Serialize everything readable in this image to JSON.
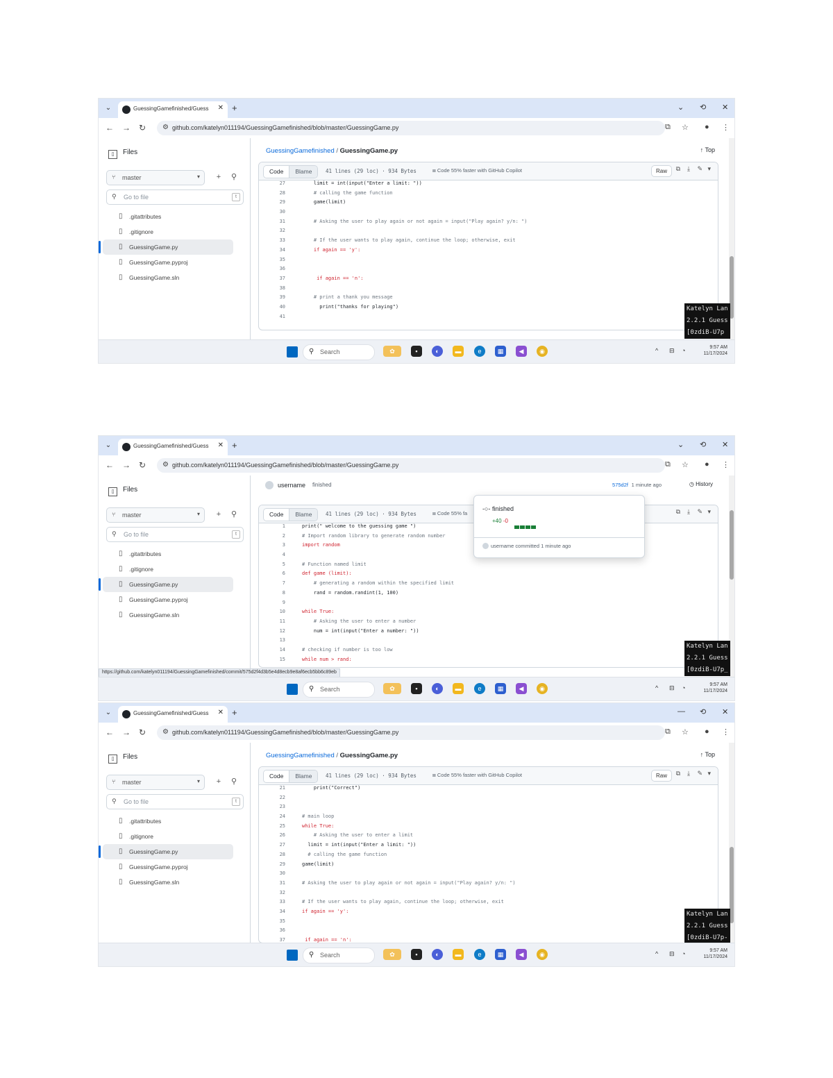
{
  "shots": [
    {
      "tab_title": "GuessingGamefinished/Guess",
      "url": "github.com/katelyn011194/GuessingGamefinished/blob/master/GuessingGame.py",
      "files_label": "Files",
      "branch": "master",
      "go_to_file": "Go to file",
      "files": [
        ".gitattributes",
        ".gitignore",
        "GuessingGame.py",
        "GuessingGame.pyproj",
        "GuessingGame.sln"
      ],
      "breadcrumb_repo": "GuessingGamefinished",
      "breadcrumb_sep": "/",
      "breadcrumb_file": "GuessingGame.py",
      "top_link": "Top",
      "view_code": "Code",
      "view_blame": "Blame",
      "file_info": "41 lines (29 loc) · 934 Bytes",
      "copilot": "Code 55% faster with GitHub Copilot",
      "raw": "Raw",
      "code_lines": [
        {
          "n": "27",
          "t": "    limit = int(input(\"Enter a limit: \"))"
        },
        {
          "n": "28",
          "t": "    # calling the game function"
        },
        {
          "n": "29",
          "t": "    game(limit)"
        },
        {
          "n": "30",
          "t": ""
        },
        {
          "n": "31",
          "t": "    # Asking the user to play again or not again = input(\"Play again? y/n: \")"
        },
        {
          "n": "32",
          "t": ""
        },
        {
          "n": "33",
          "t": "    # If the user wants to play again, continue the loop; otherwise, exit"
        },
        {
          "n": "34",
          "t": "    if again == 'y':"
        },
        {
          "n": "35",
          "t": ""
        },
        {
          "n": "36",
          "t": ""
        },
        {
          "n": "37",
          "t": "     if again == 'n':"
        },
        {
          "n": "38",
          "t": ""
        },
        {
          "n": "39",
          "t": "    # print a thank you message"
        },
        {
          "n": "40",
          "t": "      print(\"thanks for playing\")"
        },
        {
          "n": "41",
          "t": ""
        }
      ],
      "overlay": [
        "Katelyn Lan",
        "2.2.1 Guess",
        "[0zdiB-U7p"
      ],
      "clock_time": "9:57 AM",
      "clock_date": "11/17/2024",
      "search_label": "Search"
    },
    {
      "tab_title": "GuessingGamefinished/Guess",
      "url": "github.com/katelyn011194/GuessingGamefinished/blob/master/GuessingGame.py",
      "files_label": "Files",
      "branch": "master",
      "go_to_file": "Go to file",
      "files": [
        ".gitattributes",
        ".gitignore",
        "GuessingGame.py",
        "GuessingGame.pyproj",
        "GuessingGame.sln"
      ],
      "commit_user": "username",
      "commit_msg": "finished",
      "commit_sha": "575d2f",
      "commit_ago": "1 minute ago",
      "history": "History",
      "view_code": "Code",
      "view_blame": "Blame",
      "file_info": "41 lines (29 loc) · 934 Bytes",
      "copilot": "Code 55% fa",
      "code_lines": [
        {
          "n": "1",
          "t": "print(\" welcome to the guessing game \")"
        },
        {
          "n": "2",
          "t": "# Import random library to generate random number"
        },
        {
          "n": "3",
          "t": "import random"
        },
        {
          "n": "4",
          "t": ""
        },
        {
          "n": "5",
          "t": "# Function named limit"
        },
        {
          "n": "6",
          "t": "def game (limit):"
        },
        {
          "n": "7",
          "t": "    # generating a random within the specified limit"
        },
        {
          "n": "8",
          "t": "    rand = random.randint(1, 100)"
        },
        {
          "n": "9",
          "t": ""
        },
        {
          "n": "10",
          "t": "while True:"
        },
        {
          "n": "11",
          "t": "    # Asking the user to enter a number"
        },
        {
          "n": "12",
          "t": "    num = int(input(\"Enter a number: \"))"
        },
        {
          "n": "13",
          "t": ""
        },
        {
          "n": "14",
          "t": "# checking if number is too low"
        },
        {
          "n": "15",
          "t": "while num > rand:"
        }
      ],
      "popover_title": "finished",
      "popover_add": "+40",
      "popover_del": "-0",
      "popover_foot": "username committed 1 minute ago",
      "status_url": "https://github.com/katelyn011194/GuessingGamefinished/commit/575d2f4d3b5e4d8ecb9e8af6ecb5bb6c89eb",
      "overlay": [
        "Katelyn Lan",
        "2.2.1 Guess",
        "[0zdiB-U7p_"
      ],
      "clock_time": "9:57 AM",
      "clock_date": "11/17/2024",
      "search_label": "Search"
    },
    {
      "tab_title": "GuessingGamefinished/Guess",
      "url": "github.com/katelyn011194/GuessingGamefinished/blob/master/GuessingGame.py",
      "files_label": "Files",
      "branch": "master",
      "go_to_file": "Go to file",
      "files": [
        ".gitattributes",
        ".gitignore",
        "GuessingGame.py",
        "GuessingGame.pyproj",
        "GuessingGame.sln"
      ],
      "breadcrumb_repo": "GuessingGamefinished",
      "breadcrumb_sep": "/",
      "breadcrumb_file": "GuessingGame.py",
      "top_link": "Top",
      "view_code": "Code",
      "view_blame": "Blame",
      "file_info": "41 lines (29 loc) · 934 Bytes",
      "copilot": "Code 55% faster with GitHub Copilot",
      "raw": "Raw",
      "code_lines": [
        {
          "n": "21",
          "t": "    print(\"Correct\")"
        },
        {
          "n": "22",
          "t": ""
        },
        {
          "n": "23",
          "t": ""
        },
        {
          "n": "24",
          "t": "# main loop"
        },
        {
          "n": "25",
          "t": "while True:"
        },
        {
          "n": "26",
          "t": "    # Asking the user to enter a limit"
        },
        {
          "n": "27",
          "t": "  limit = int(input(\"Enter a limit: \"))"
        },
        {
          "n": "28",
          "t": "  # calling the game function"
        },
        {
          "n": "29",
          "t": "game(limit)"
        },
        {
          "n": "30",
          "t": ""
        },
        {
          "n": "31",
          "t": "# Asking the user to play again or not again = input(\"Play again? y/n: \")"
        },
        {
          "n": "32",
          "t": ""
        },
        {
          "n": "33",
          "t": "# If the user wants to play again, continue the loop; otherwise, exit"
        },
        {
          "n": "34",
          "t": "if again == 'y':"
        },
        {
          "n": "35",
          "t": ""
        },
        {
          "n": "36",
          "t": ""
        },
        {
          "n": "37",
          "t": " if again == 'n':"
        }
      ],
      "overlay": [
        "Katelyn Lan",
        "2.2.1 Guess",
        "[0zdiB-U7p-"
      ],
      "clock_time": "9:57 AM",
      "clock_date": "11/17/2024",
      "search_label": "Search"
    }
  ],
  "colors": {
    "accent": "#0969da",
    "tabbar": "#dbe6f8",
    "added": "#1a7f37",
    "keyword": "#cf222e"
  },
  "icons": {
    "nav": [
      "arrow-left-icon",
      "arrow-right-icon",
      "reload-icon"
    ],
    "taskbar": [
      "windows-icon",
      "search-icon",
      "widgets-icon",
      "task-view-icon",
      "copilot-icon",
      "file-explorer-icon",
      "edge-icon",
      "store-icon",
      "visual-studio-icon",
      "chrome-icon"
    ]
  }
}
